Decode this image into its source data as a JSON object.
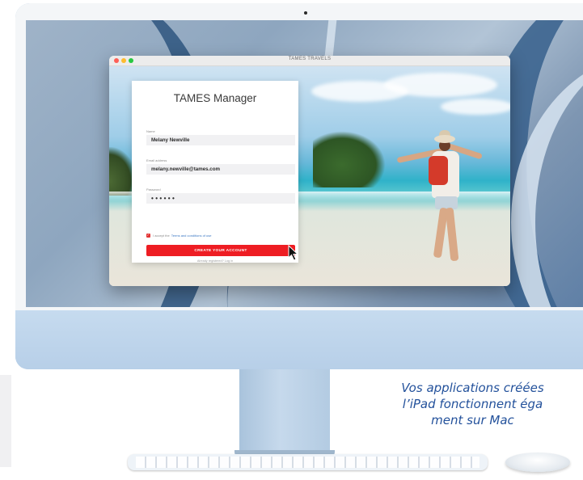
{
  "window": {
    "title": "TAMES TRAVELS"
  },
  "signup": {
    "heading": "TAMES Manager",
    "name_label": "Name",
    "name_value": "Melany Newville",
    "email_label": "Email address",
    "email_value": "melany.newville@tames.com",
    "password_label": "Password",
    "password_value": "••••••",
    "terms_prefix": "I accept the",
    "terms_link": "Terms and conditions of use",
    "create_button": "CREATE YOUR ACCOUNT",
    "login_prompt": "Already registered? Log in"
  },
  "caption": {
    "line1": "Vos applications créées",
    "line2": "l’iPad fonctionnent éga",
    "line3": "ment sur Mac"
  },
  "colors": {
    "accent": "#ee1d23",
    "caption_text": "#23519b",
    "imac_body": "#cfe1f2"
  },
  "icons": [
    "close-icon",
    "minimize-icon",
    "maximize-icon",
    "checkbox-checked-icon",
    "mouse-pointer-icon"
  ]
}
